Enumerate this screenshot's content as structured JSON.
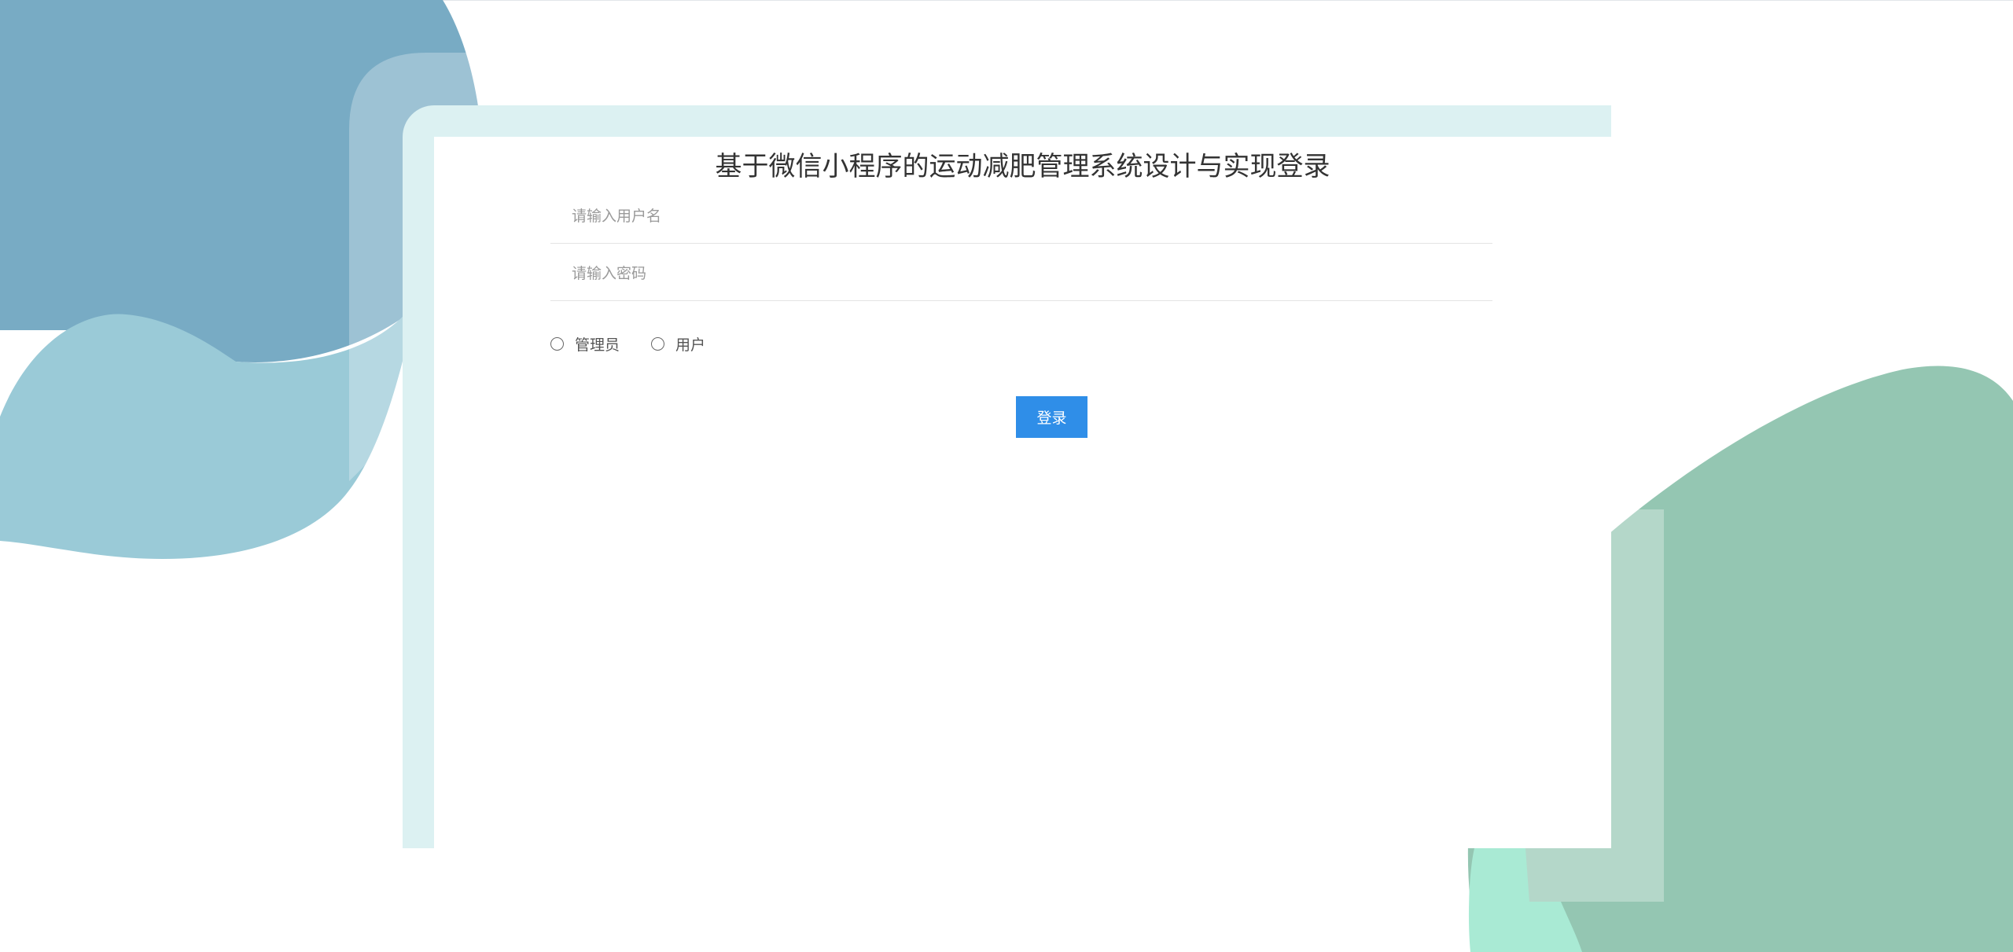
{
  "login": {
    "title": "基于微信小程序的运动减肥管理系统设计与实现登录",
    "username_placeholder": "请输入用户名",
    "password_placeholder": "请输入密码",
    "roles": [
      {
        "label": "管理员",
        "selected": false
      },
      {
        "label": "用户",
        "selected": false
      }
    ],
    "submit_label": "登录"
  },
  "colors": {
    "accent": "#2f8ee8",
    "frame": "#dcf1f2",
    "blob_blue_dark": "#78abc4",
    "blob_blue_light": "#9acad7",
    "blob_green": "#94c6b2"
  }
}
